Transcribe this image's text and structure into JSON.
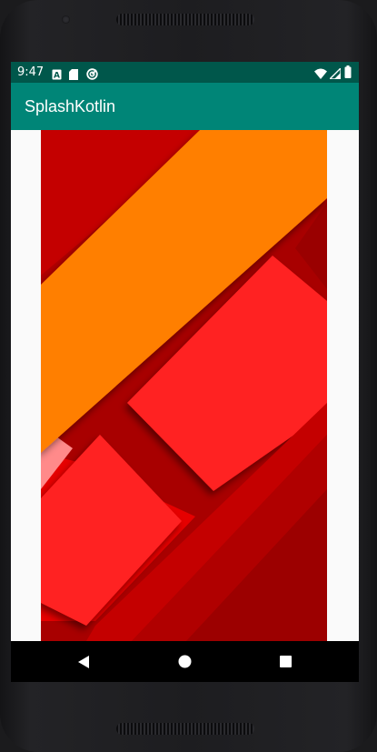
{
  "status_bar": {
    "time": "9:47",
    "left_icons": [
      "sim-card-icon",
      "sd-card-icon",
      "sync-icon"
    ],
    "right_icons": [
      "wifi-icon",
      "cell-signal-icon",
      "battery-icon"
    ]
  },
  "app_bar": {
    "title": "SplashKotlin"
  },
  "content": {
    "image_icon": "material-wallpaper-image"
  },
  "nav_bar": {
    "buttons": [
      "back-icon",
      "home-icon",
      "recents-icon"
    ]
  },
  "colors": {
    "status_bar": "#00574b",
    "app_bar": "#008577",
    "content_background": "#fafafa",
    "nav_bar": "#000000",
    "wallpaper_base": "#a80000",
    "wallpaper_orange": "#ff7f00",
    "wallpaper_red": "#ff2020",
    "wallpaper_pink": "#ff8a8a"
  }
}
